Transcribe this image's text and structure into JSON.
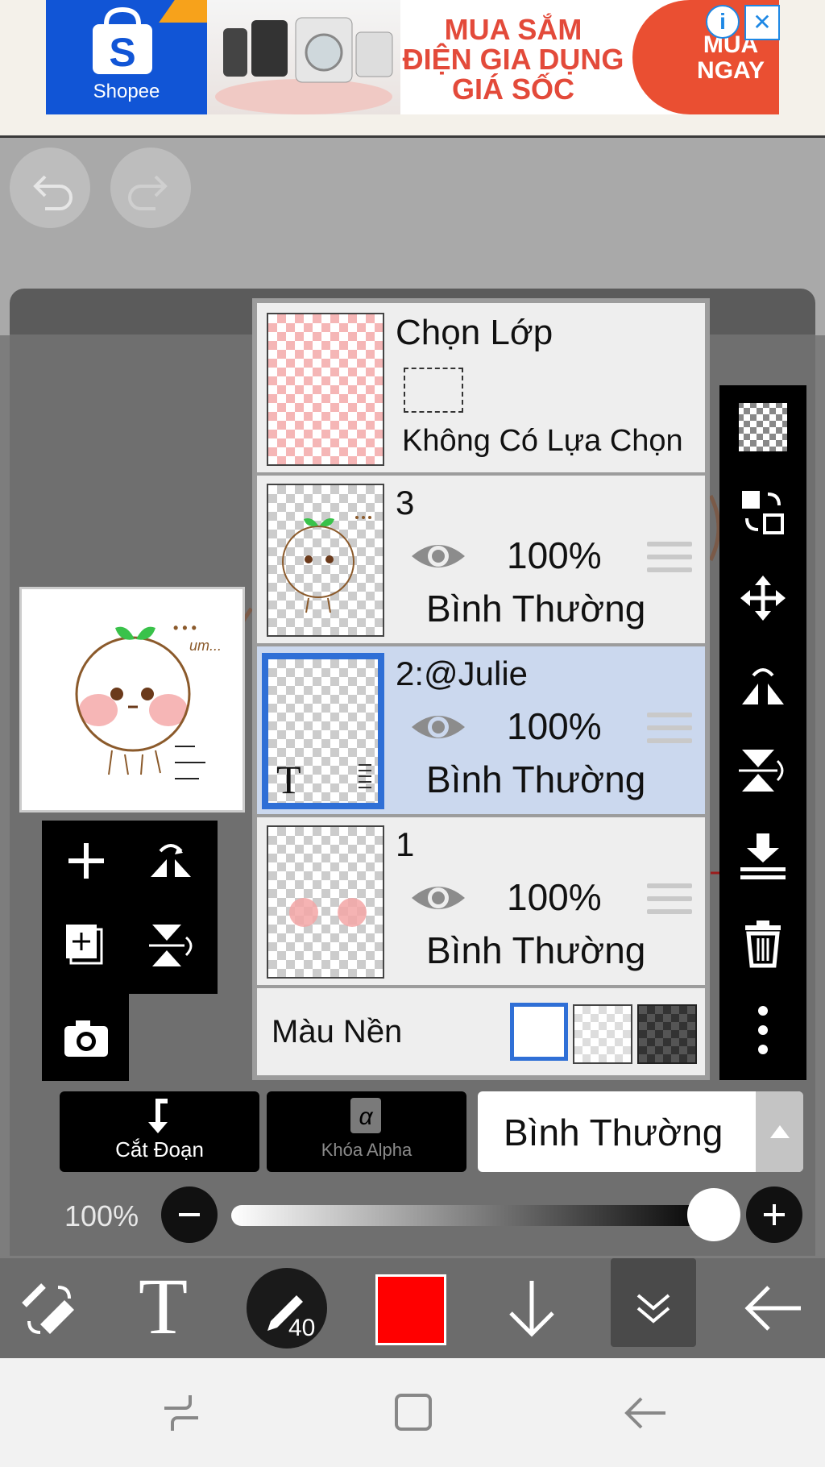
{
  "ad": {
    "brand": "Shopee",
    "headline_line1": "MUA SẮM",
    "headline_line2": "ĐIỆN GIA DỤNG",
    "headline_line3": "GIÁ SỐC",
    "cta_line1": "MUA",
    "cta_line2": "NGAY",
    "info_icon": "i",
    "close_icon": "✕"
  },
  "preview": {
    "ellipsis_text": "• • •",
    "um_text": "um..."
  },
  "layers_panel": {
    "selection": {
      "title": "Chọn Lớp",
      "status": "Không Có Lựa Chọn"
    },
    "layers": [
      {
        "name": "3",
        "opacity": "100%",
        "mode": "Bình Thường"
      },
      {
        "name": "2:@Julie",
        "opacity": "100%",
        "mode": "Bình Thường",
        "thumb_text": "T"
      },
      {
        "name": "1",
        "opacity": "100%",
        "mode": "Bình Thường"
      }
    ],
    "background_label": "Màu Nền"
  },
  "bottom_controls": {
    "clipping_label": "Cắt Đoạn",
    "alpha_lock_label": "Khóa Alpha",
    "alpha_symbol": "α",
    "blend_mode": "Bình Thường",
    "opacity_value": "100%",
    "opacity_fraction": 1.0
  },
  "toolbar": {
    "brush_size": "40",
    "text_tool_glyph": "T",
    "current_color": "#ff0000"
  },
  "colors": {
    "accent_blue": "#2f6fd6",
    "selected_row": "#cbd8ee",
    "shopee_blue": "#1155d6",
    "ad_red": "#e34a3a"
  }
}
